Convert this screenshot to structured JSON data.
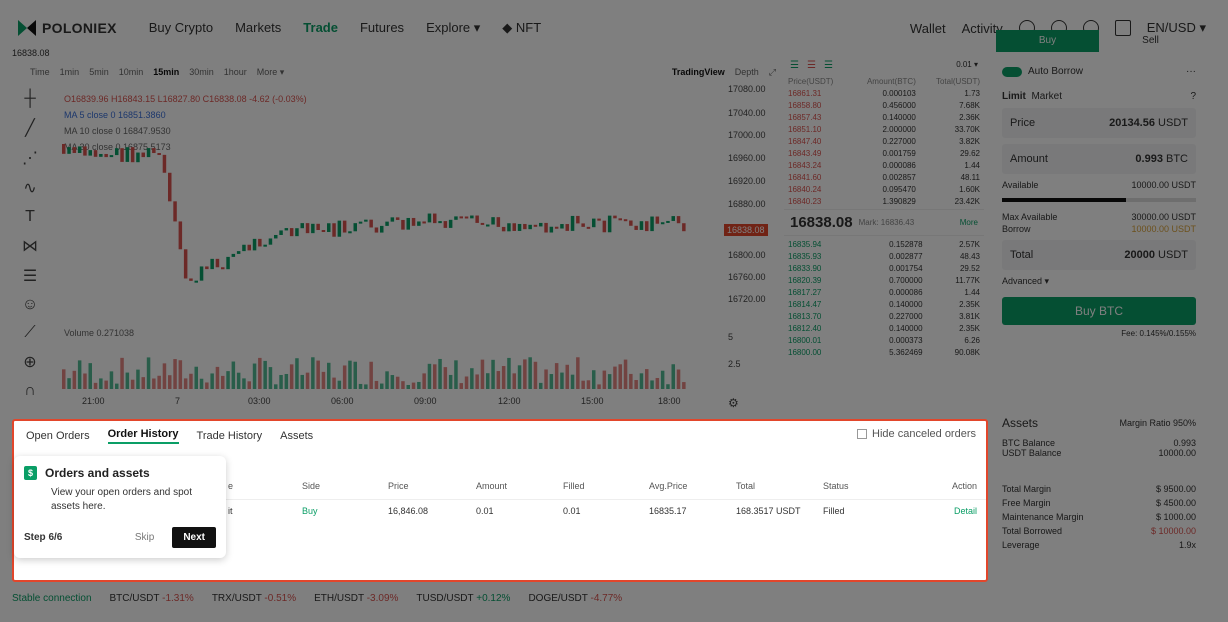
{
  "header": {
    "brand": "POLONIEX",
    "nav": [
      "Buy Crypto",
      "Markets",
      "Trade",
      "Futures",
      "Explore ▾",
      "◆ NFT"
    ],
    "wallet": "Wallet",
    "activity": "Activity",
    "lang": "EN/USD ▾"
  },
  "subprice": "16838.08",
  "toolbar": {
    "items": [
      "Time",
      "1min",
      "5min",
      "10min",
      "15min",
      "30min",
      "1hour",
      "More ▾"
    ],
    "tradingview": "TradingView",
    "depth": "Depth"
  },
  "chart": {
    "ohlc": "O16839.96 H16843.15 L16827.80 C16838.08 -4.62 (-0.03%)",
    "ma1": "MA 5 close 0  16851.3860",
    "ma2": "MA 10 close 0  16847.9530",
    "ma3": "MA 30 close 0  16875.5173",
    "volume": "Volume  0.271038",
    "times": [
      "21:00",
      "7",
      "03:00",
      "06:00",
      "09:00",
      "12:00",
      "15:00",
      "18:00"
    ],
    "yaxis": [
      "17080.00",
      "17040.00",
      "17000.00",
      "16960.00",
      "16920.00",
      "16880.00",
      "16838.08",
      "16800.00",
      "16760.00",
      "16720.00",
      "5",
      "2.5"
    ]
  },
  "orderbook": {
    "precision": "0.01 ▾",
    "headers": [
      "Price(USDT)",
      "Amount(BTC)",
      "Total(USDT)"
    ],
    "asks": [
      [
        "16861.31",
        "0.000103",
        "1.73"
      ],
      [
        "16858.80",
        "0.456000",
        "7.68K"
      ],
      [
        "16857.43",
        "0.140000",
        "2.36K"
      ],
      [
        "16851.10",
        "2.000000",
        "33.70K"
      ],
      [
        "16847.40",
        "0.227000",
        "3.82K"
      ],
      [
        "16843.49",
        "0.001759",
        "29.62"
      ],
      [
        "16843.24",
        "0.000086",
        "1.44"
      ],
      [
        "16841.60",
        "0.002857",
        "48.11"
      ],
      [
        "16840.24",
        "0.095470",
        "1.60K"
      ],
      [
        "16840.23",
        "1.390829",
        "23.42K"
      ]
    ],
    "mid": "16838.08",
    "mark": "Mark: 16836.43",
    "more": "More",
    "bids": [
      [
        "16835.94",
        "0.152878",
        "2.57K"
      ],
      [
        "16835.93",
        "0.002877",
        "48.43"
      ],
      [
        "16833.90",
        "0.001754",
        "29.52"
      ],
      [
        "16820.39",
        "0.700000",
        "11.77K"
      ],
      [
        "16817.27",
        "0.000086",
        "1.44"
      ],
      [
        "16814.47",
        "0.140000",
        "2.35K"
      ],
      [
        "16813.70",
        "0.227000",
        "3.81K"
      ],
      [
        "16812.40",
        "0.140000",
        "2.35K"
      ],
      [
        "16800.01",
        "0.000373",
        "6.26"
      ],
      [
        "16800.00",
        "5.362469",
        "90.08K"
      ]
    ]
  },
  "trade": {
    "buy": "Buy",
    "sell": "Sell",
    "autoborrow": "Auto Borrow",
    "limit": "Limit",
    "market": "Market",
    "price_label": "Price",
    "price": "20134.56",
    "unit": "USDT",
    "amount_label": "Amount",
    "amount": "0.993",
    "amount_unit": "BTC",
    "available_label": "Available",
    "available": "10000.00 USDT",
    "maxavail_label": "Max Available",
    "maxavail": "30000.00 USDT",
    "borrow_label": "Borrow",
    "borrow": "10000.00 USDT",
    "total_label": "Total",
    "total": "20000",
    "advanced": "Advanced ▾",
    "buy_btn": "Buy BTC",
    "fee": "Fee: 0.145%/0.155%"
  },
  "assets": {
    "title": "Assets",
    "margin_ratio": "Margin Ratio 950%",
    "rows": [
      [
        "BTC Balance",
        "0.993"
      ],
      [
        "USDT Balance",
        "10000.00"
      ]
    ],
    "margin": [
      [
        "Total Margin",
        "$ 9500.00"
      ],
      [
        "Free Margin",
        "$ 4500.00"
      ],
      [
        "Maintenance Margin",
        "$ 1000.00"
      ],
      [
        "Total Borrowed",
        "$ 10000.00"
      ],
      [
        "Leverage",
        "1.9x"
      ]
    ]
  },
  "orders": {
    "tabs": [
      "Open Orders",
      "Order History",
      "Trade History",
      "Assets"
    ],
    "hide": "Hide canceled orders",
    "columns": [
      "Side",
      "Price",
      "Amount",
      "Filled",
      "Avg.Price",
      "Total",
      "Status",
      "Action"
    ],
    "row": [
      "Buy",
      "16,846.08",
      "0.01",
      "0.01",
      "16835.17",
      "168.3517 USDT",
      "Filled",
      "Detail"
    ],
    "partial_col": "e",
    "partial_row": "it"
  },
  "tip": {
    "title": "Orders and assets",
    "desc": "View your open orders and spot assets here.",
    "step": "Step 6/6",
    "skip": "Skip",
    "next": "Next"
  },
  "status": {
    "conn": "Stable connection",
    "tickers": [
      [
        "BTC/USDT",
        "-1.31%"
      ],
      [
        "TRX/USDT",
        "-0.51%"
      ],
      [
        "ETH/USDT",
        "-3.09%"
      ],
      [
        "TUSD/USDT",
        "+0.12%"
      ],
      [
        "DOGE/USDT",
        "-4.77%"
      ]
    ]
  }
}
